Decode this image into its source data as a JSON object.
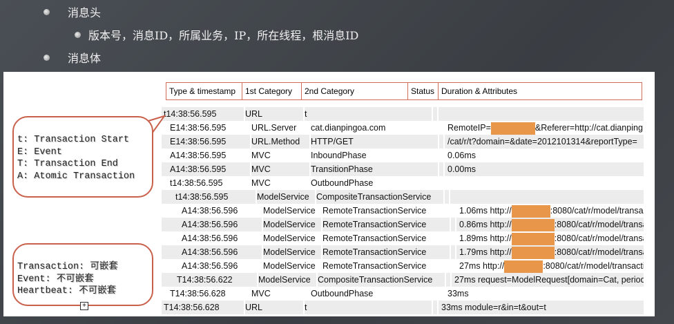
{
  "slide": {
    "bullets": [
      {
        "text": "消息头",
        "level": 1
      },
      {
        "text": "版本号，消息ID，所属业务，IP，所在线程，根消息ID",
        "level": 2
      },
      {
        "text": "消息体",
        "level": 1
      }
    ]
  },
  "table": {
    "headers": [
      "Type & timestamp",
      "1st Category",
      "2nd Category",
      "Status",
      "Duration & Attributes"
    ],
    "rows": [
      {
        "type": "t14:38:56.595",
        "cat1": "URL",
        "cat2": "t",
        "status": "",
        "attr": "",
        "attr2": "",
        "masked": false
      },
      {
        "type": "E14:38:56.595",
        "cat1": "URL.Server",
        "cat2": "cat.dianpingoa.com",
        "status": "",
        "attr": "RemoteIP=",
        "attr2": "&Referer=http://cat.dianping",
        "masked": true
      },
      {
        "type": "E14:38:56.595",
        "cat1": "URL.Method",
        "cat2": "HTTP/GET",
        "status": "",
        "attr": "/cat/r/t?domain=&date=2012101314&reportType=",
        "attr2": "",
        "masked": false
      },
      {
        "type": "A14:38:56.595",
        "cat1": "MVC",
        "cat2": "InboundPhase",
        "status": "",
        "attr": "0.06ms",
        "attr2": "",
        "masked": false
      },
      {
        "type": "A14:38:56.595",
        "cat1": "MVC",
        "cat2": "TransitionPhase",
        "status": "",
        "attr": "0.00ms",
        "attr2": "",
        "masked": false
      },
      {
        "type": "t14:38:56.595",
        "cat1": "MVC",
        "cat2": "OutboundPhase",
        "status": "",
        "attr": "",
        "attr2": "",
        "masked": false
      },
      {
        "type": "t14:38:56.595",
        "cat1": "ModelService",
        "cat2": "CompositeTransactionService",
        "status": "",
        "attr": "",
        "attr2": "",
        "masked": false
      },
      {
        "type": "A14:38:56.596",
        "cat1": "ModelService",
        "cat2": "RemoteTransactionService",
        "status": "",
        "attr": "1.06ms http://",
        "attr2": ":8080/cat/r/model/transact",
        "masked": true
      },
      {
        "type": "A14:38:56.596",
        "cat1": "ModelService",
        "cat2": "RemoteTransactionService",
        "status": "",
        "attr": "0.86ms http://",
        "attr2": ":8080/cat/r/model/transac",
        "masked": true
      },
      {
        "type": "A14:38:56.596",
        "cat1": "ModelService",
        "cat2": "RemoteTransactionService",
        "status": "",
        "attr": "1.89ms http://",
        "attr2": ":8080/cat/r/model/transac",
        "masked": true
      },
      {
        "type": "A14:38:56.596",
        "cat1": "ModelService",
        "cat2": "RemoteTransactionService",
        "status": "",
        "attr": "1.79ms http://",
        "attr2": ":8080/cat/r/model/transac",
        "masked": true
      },
      {
        "type": "A14:38:56.596",
        "cat1": "ModelService",
        "cat2": "RemoteTransactionService",
        "status": "",
        "attr": "27ms http://",
        "attr2": ":8080/cat/r/model/transacti",
        "masked": true
      },
      {
        "type": "T14:38:56.622",
        "cat1": "ModelService",
        "cat2": "CompositeTransactionService",
        "status": "",
        "attr": "27ms request=ModelRequest[domain=Cat, period",
        "attr2": "",
        "masked": false
      },
      {
        "type": "T14:38:56.628",
        "cat1": "MVC",
        "cat2": "OutboundPhase",
        "status": "",
        "attr": "33ms",
        "attr2": "",
        "masked": false
      },
      {
        "type": "T14:38:56.628",
        "cat1": "URL",
        "cat2": "t",
        "status": "",
        "attr": "33ms module=r&in=t&out=t",
        "attr2": "",
        "masked": false
      }
    ]
  },
  "legend_types": [
    "t: Transaction Start",
    "E: Event",
    "T: Transaction End",
    "A: Atomic Transaction"
  ],
  "legend_nesting": [
    "Transaction: 可嵌套",
    "Event: 不可嵌套",
    "Heartbeat: 不可嵌套"
  ],
  "colors": {
    "border": "#d06a5a",
    "mask": "#e8974a",
    "row_shade": "#ececec"
  }
}
